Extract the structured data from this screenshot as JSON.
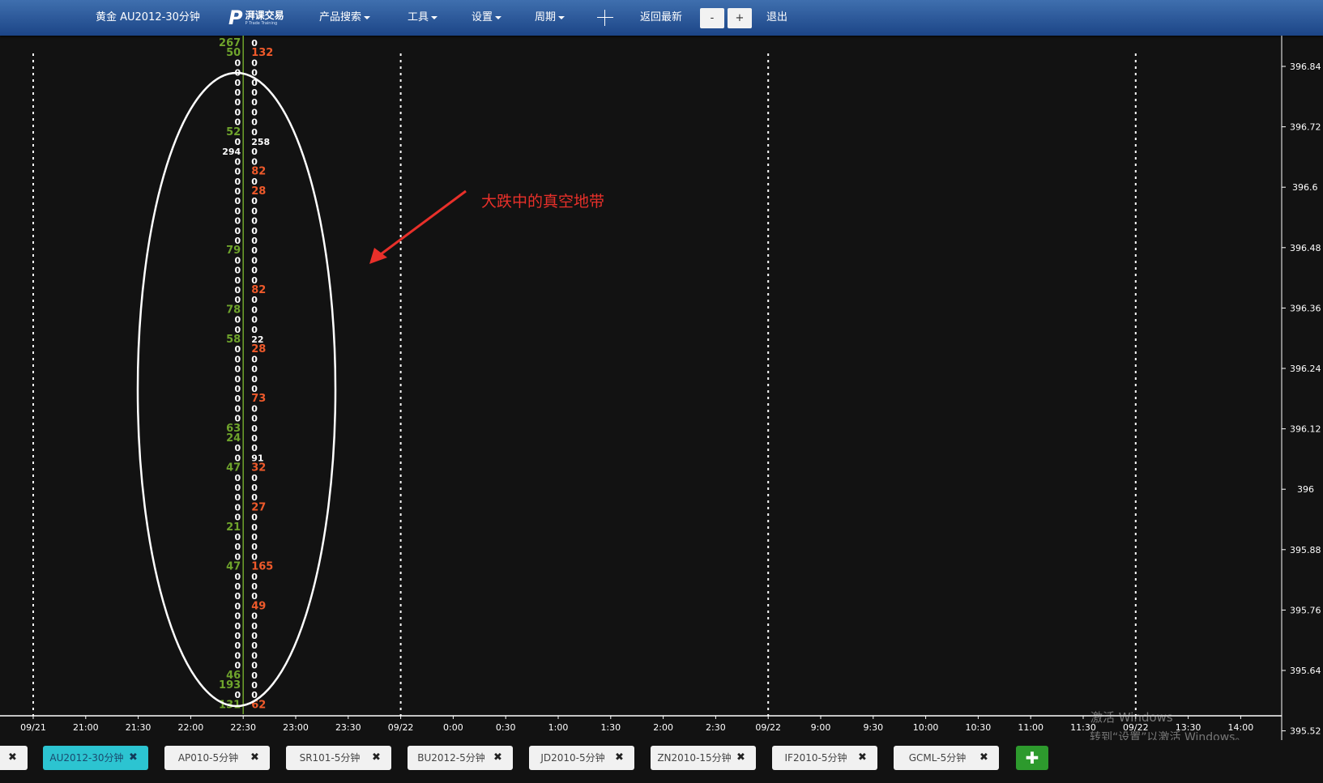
{
  "toolbar": {
    "title": "黄金 AU2012-30分钟",
    "logo_mark": "P",
    "logo_name": "湃课交易",
    "logo_sub": "P Trade Training",
    "menu": {
      "product_search": "产品搜索",
      "tools": "工具",
      "settings": "设置",
      "period": "周期"
    },
    "return_latest": "返回最新",
    "zoom_out": "-",
    "zoom_in": "+",
    "exit": "退出"
  },
  "annotation": {
    "text": "大跌中的真空地带",
    "color": "#e8302a"
  },
  "chart_data": {
    "type": "footprint",
    "y_axis_labels": [
      "396.84",
      "396.72",
      "396.6",
      "396.48",
      "396.36",
      "396.24",
      "396.12",
      "396",
      "395.88",
      "395.76",
      "395.64",
      "395.52"
    ],
    "ylim": [
      395.52,
      396.84
    ],
    "x_axis_labels": [
      "09/21",
      "21:00",
      "21:30",
      "22:00",
      "22:30",
      "23:00",
      "23:30",
      "09/22",
      "0:00",
      "0:30",
      "1:00",
      "1:30",
      "2:00",
      "2:30",
      "09/22",
      "9:00",
      "9:30",
      "10:00",
      "10:30",
      "11:00",
      "11:30",
      "09/22",
      "13:30",
      "14:00"
    ],
    "date_separator_labels": [
      "09/21",
      "09/22",
      "09/22",
      "09/22"
    ],
    "footprint": {
      "bar_time": "22:30",
      "left": [
        "267",
        "50",
        "0",
        "0",
        "0",
        "0",
        "0",
        "0",
        "0",
        "52",
        "0",
        "294",
        "0",
        "0",
        "0",
        "0",
        "0",
        "0",
        "0",
        "0",
        "0",
        "79",
        "0",
        "0",
        "0",
        "0",
        "0",
        "78",
        "0",
        "0",
        "58",
        "0",
        "0",
        "0",
        "0",
        "0",
        "0",
        "0",
        "0",
        "63",
        "24",
        "0",
        "0",
        "47",
        "0",
        "0",
        "0",
        "0",
        "0",
        "21",
        "0",
        "0",
        "0",
        "47",
        "0",
        "0",
        "0",
        "0",
        "0",
        "0",
        "0",
        "0",
        "0",
        "0",
        "46",
        "193",
        "0",
        "131"
      ],
      "right": [
        "0",
        "132",
        "0",
        "0",
        "0",
        "0",
        "0",
        "0",
        "0",
        "0",
        "258",
        "0",
        "0",
        "82",
        "0",
        "28",
        "0",
        "0",
        "0",
        "0",
        "0",
        "0",
        "0",
        "0",
        "0",
        "82",
        "0",
        "0",
        "0",
        "0",
        "22",
        "28",
        "0",
        "0",
        "0",
        "0",
        "73",
        "0",
        "0",
        "0",
        "0",
        "0",
        "91",
        "32",
        "0",
        "0",
        "0",
        "27",
        "0",
        "0",
        "0",
        "0",
        "0",
        "165",
        "0",
        "0",
        "0",
        "49",
        "0",
        "0",
        "0",
        "0",
        "0",
        "0",
        "0",
        "0",
        "0",
        "62"
      ],
      "highlight_left": [
        "267",
        "50",
        "52",
        "79",
        "78",
        "58",
        "63",
        "24",
        "21",
        "47",
        "46",
        "193",
        "131"
      ],
      "highlight_right": [
        "132",
        "82",
        "28",
        "82",
        "28",
        "73",
        "32",
        "27",
        "165",
        "49",
        "62"
      ],
      "colors": {
        "buy": "#6fa42c",
        "sell": "#ef5a2b",
        "neutral": "#ffffff",
        "bar_line": "#6fa42c"
      }
    },
    "grid": false
  },
  "watermark": {
    "line1": "激活 Windows",
    "line2": "转到“设置”以激活 Windows。"
  },
  "tabs": [
    {
      "label": "",
      "close": "✖",
      "partial": true
    },
    {
      "label": "AU2012-30分钟",
      "close": "✖",
      "active": true
    },
    {
      "label": "AP010-5分钟",
      "close": "✖"
    },
    {
      "label": "SR101-5分钟",
      "close": "✖"
    },
    {
      "label": "BU2012-5分钟",
      "close": "✖"
    },
    {
      "label": "JD2010-5分钟",
      "close": "✖"
    },
    {
      "label": "ZN2010-15分钟",
      "close": "✖"
    },
    {
      "label": "IF2010-5分钟",
      "close": "✖"
    },
    {
      "label": "GCML-5分钟",
      "close": "✖"
    }
  ],
  "add_tab": "✚"
}
